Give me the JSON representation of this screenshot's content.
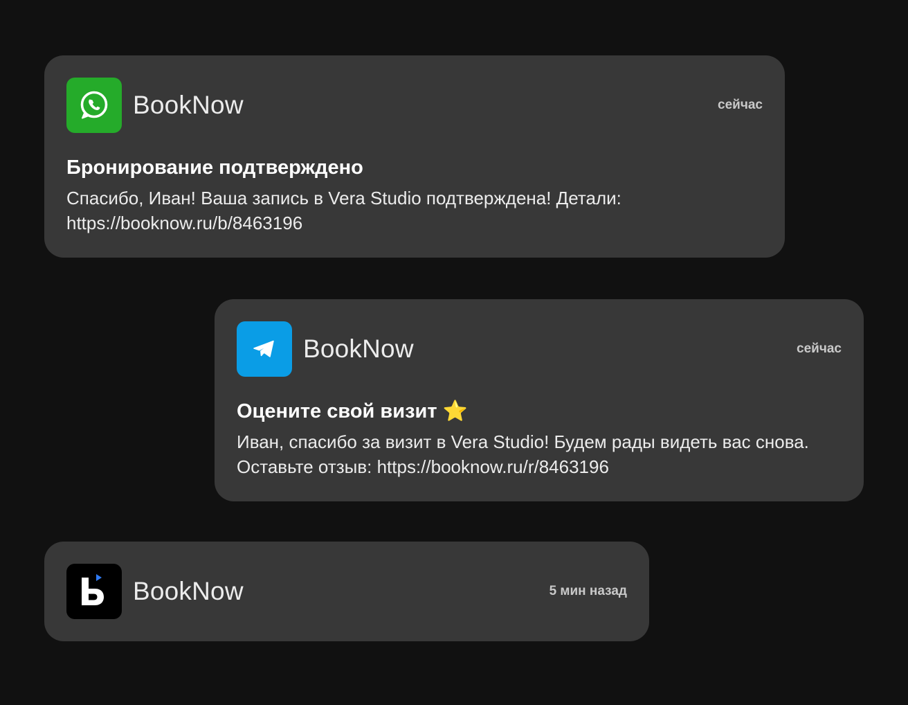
{
  "notifications": [
    {
      "app_name": "BookNow",
      "app_icon": "whatsapp-icon",
      "icon_bg": "#25AB2A",
      "time": "сейчас",
      "title": "Бронирование подтверждено",
      "body": "Спасибо, Иван! Ваша запись в Vera Studio подтверждена! Детали: https://booknow.ru/b/8463196"
    },
    {
      "app_name": "BookNow",
      "app_icon": "telegram-icon",
      "icon_bg": "#0A9DE6",
      "time": "сейчас",
      "title": "Оцените свой визит ⭐",
      "body": "Иван, спасибо за визит в Vera Studio! Будем рады видеть вас снова. Оставьте отзыв: https://booknow.ru/r/8463196"
    },
    {
      "app_name": "BookNow",
      "app_icon": "booknow-logo-icon",
      "icon_bg": "#000000",
      "accent": "#2F7BF5",
      "time": "5 мин назад"
    }
  ]
}
